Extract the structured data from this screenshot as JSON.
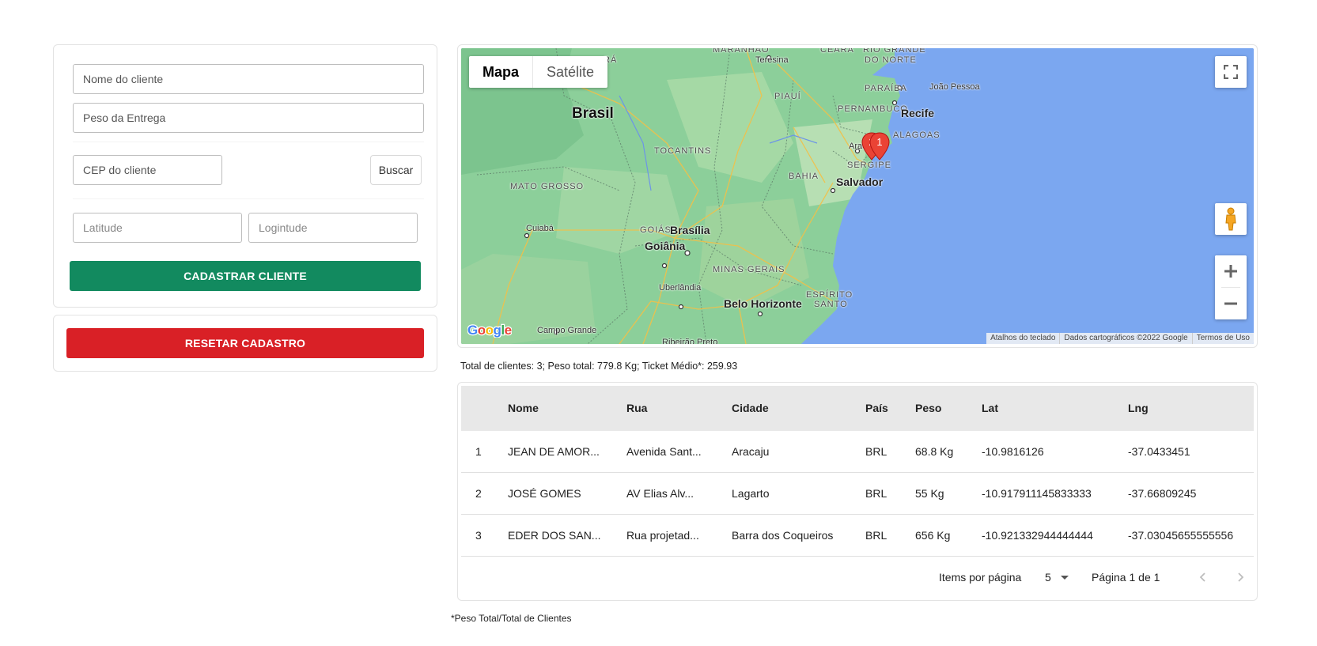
{
  "form": {
    "nome_placeholder": "Nome do cliente",
    "peso_placeholder": "Peso da Entrega",
    "cep_placeholder": "CEP do cliente",
    "buscar_label": "Buscar",
    "lat_placeholder": "Latitude",
    "lng_placeholder": "Logintude",
    "cadastrar_label": "CADASTRAR CLIENTE",
    "resetar_label": "RESETAR CADASTRO",
    "colors": {
      "primary": "#128a5f",
      "danger": "#d92026"
    }
  },
  "map": {
    "type_tabs": [
      "Mapa",
      "Satélite"
    ],
    "active_tab": "Mapa",
    "labels": {
      "maranhao": "MARANHÃO",
      "teresina": "Teresina",
      "ceara": "CEARÁ",
      "rio_grande": "RIO GRANDE",
      "do_norte": "DO NORTE",
      "paraiba": "PARAÍBA",
      "joao_pessoa": "João Pessoa",
      "piaui": "PIAUÍ",
      "pernambuco": "PERNAMBUCO",
      "recife": "Recife",
      "alagoas": "ALAGOAS",
      "aracaju": "Aracaju",
      "sergipe": "SERGIPE",
      "brasil": "Brasil",
      "tocantins": "TOCANTINS",
      "bahia": "BAHIA",
      "salvador": "Salvador",
      "mato_grosso": "MATO GROSSO",
      "cuiaba": "Cuiabá",
      "goias": "GOIÁS",
      "brasilia": "Brasília",
      "goiania": "Goiânia",
      "minas_gerais": "MINAS GERAIS",
      "uberlandia": "Uberlândia",
      "belo_horizonte": "Belo Horizonte",
      "espirito": "ESPÍRITO",
      "santo": "SANTO",
      "campo_grande": "Campo Grande",
      "ribeirao_preto": "Ribeirão Preto",
      "ra": "RÁ"
    },
    "markers": [
      "2",
      "1"
    ],
    "footer": [
      "Atalhos do teclado",
      "Dados cartográficos ©2022 Google",
      "Termos de Uso"
    ],
    "logo": "Google"
  },
  "stats": {
    "summary": "Total de clientes: 3; Peso total: 779.8 Kg; Ticket Médio*: 259.93",
    "footnote": "*Peso Total/Total de Clientes"
  },
  "table": {
    "columns": [
      "",
      "Nome",
      "Rua",
      "Cidade",
      "País",
      "Peso",
      "Lat",
      "Lng"
    ],
    "rows": [
      {
        "idx": "1",
        "nome": "JEAN DE AMOR...",
        "rua": "Avenida Sant...",
        "cidade": "Aracaju",
        "pais": "BRL",
        "peso": "68.8 Kg",
        "lat": "-10.9816126",
        "lng": "-37.0433451"
      },
      {
        "idx": "2",
        "nome": "JOSÉ GOMES",
        "rua": "AV Elias Alv...",
        "cidade": "Lagarto",
        "pais": "BRL",
        "peso": "55 Kg",
        "lat": "-10.917911145833333",
        "lng": "-37.66809245"
      },
      {
        "idx": "3",
        "nome": "EDER DOS SAN...",
        "rua": "Rua projetad...",
        "cidade": "Barra dos Coqueiros",
        "pais": "BRL",
        "peso": "656 Kg",
        "lat": "-10.921332944444444",
        "lng": "-37.03045655555556"
      }
    ],
    "paginator": {
      "items_label": "Items por página",
      "page_size": "5",
      "range_label": "Página 1 de 1"
    }
  }
}
